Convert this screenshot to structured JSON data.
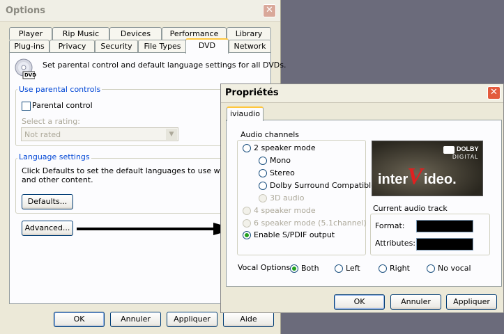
{
  "options": {
    "title": "Options",
    "tabs_row1": [
      "Player",
      "Rip Music",
      "Devices",
      "Performance",
      "Library"
    ],
    "tabs_row2": [
      "Plug-ins",
      "Privacy",
      "Security",
      "File Types",
      "DVD",
      "Network"
    ],
    "active_tab": "DVD",
    "description": "Set parental control and default language settings for all DVDs.",
    "dvd_icon_label": "DVD",
    "parental": {
      "group_title": "Use parental controls",
      "checkbox_label": "Parental control",
      "rating_label": "Select a rating:",
      "rating_value": "Not rated"
    },
    "language": {
      "group_title": "Language settings",
      "line1": "Click Defaults to set the default languages to use when play",
      "line2": "and other content.",
      "defaults_button": "Defaults..."
    },
    "advanced_button": "Advanced...",
    "footer": {
      "ok": "OK",
      "cancel": "Annuler",
      "apply": "Appliquer",
      "help": "Aide"
    }
  },
  "props": {
    "title": "Propriétés",
    "tab": "iviaudio",
    "audio_channels": {
      "title": "Audio channels",
      "two_speaker": "2 speaker mode",
      "mono": "Mono",
      "stereo": "Stereo",
      "dolby_surround": "Dolby Surround Compatible",
      "audio3d": "3D audio",
      "four_speaker": "4 speaker mode",
      "six_speaker": "6 speaker mode (5.1channel)",
      "spdif": "Enable S/PDIF output",
      "selected": "Enable S/PDIF output"
    },
    "logo": {
      "brand_left": "inter",
      "brand_v": "V",
      "brand_right": "ideo.",
      "dolby": "DOLBY",
      "digital": "DIGITAL"
    },
    "current_track": {
      "title": "Current audio track",
      "format_label": "Format:",
      "attributes_label": "Attributes:"
    },
    "vocal": {
      "label": "Vocal Options:",
      "options": [
        "Both",
        "Left",
        "Right",
        "No vocal"
      ],
      "selected": "Both"
    },
    "footer": {
      "ok": "OK",
      "cancel": "Annuler",
      "apply": "Appliquer"
    }
  },
  "colors": {
    "accent_tab": "#ffc73c",
    "group_title": "#0046d5",
    "close_red": "#e35a3c",
    "radio_dot": "#21a121"
  }
}
